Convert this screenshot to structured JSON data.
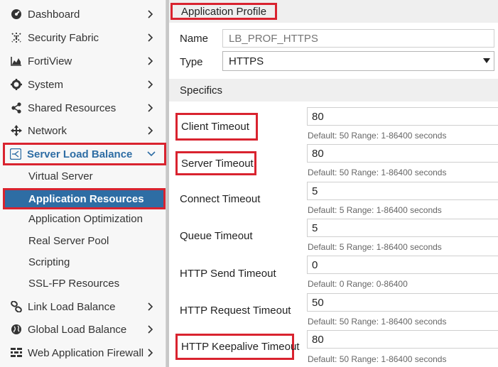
{
  "sidebar": {
    "items": [
      {
        "label": "Dashboard",
        "icon": "dashboard-icon"
      },
      {
        "label": "Security Fabric",
        "icon": "security-fabric-icon"
      },
      {
        "label": "FortiView",
        "icon": "fortiview-icon"
      },
      {
        "label": "System",
        "icon": "gear-icon"
      },
      {
        "label": "Shared Resources",
        "icon": "share-icon"
      },
      {
        "label": "Network",
        "icon": "network-icon"
      },
      {
        "label": "Server Load Balance",
        "icon": "server-load-balance-icon"
      },
      {
        "label": "Link Load Balance",
        "icon": "link-icon"
      },
      {
        "label": "Global Load Balance",
        "icon": "globe-icon"
      },
      {
        "label": "Web Application Firewall",
        "icon": "firewall-icon"
      }
    ],
    "sub_items": [
      {
        "label": "Virtual Server"
      },
      {
        "label": "Application Resources"
      },
      {
        "label": "Application Optimization"
      },
      {
        "label": "Real Server Pool"
      },
      {
        "label": "Scripting"
      },
      {
        "label": "SSL-FP Resources"
      }
    ]
  },
  "main": {
    "header": "Application Profile",
    "name_label": "Name",
    "name_placeholder": "LB_PROF_HTTPS",
    "type_label": "Type",
    "type_value": "HTTPS",
    "specifics_header": "Specifics",
    "fields": [
      {
        "label": "Client Timeout",
        "value": "80",
        "hint": "Default: 50 Range: 1-86400 seconds"
      },
      {
        "label": "Server Timeout",
        "value": "80",
        "hint": "Default: 50 Range: 1-86400 seconds"
      },
      {
        "label": "Connect Timeout",
        "value": "5",
        "hint": "Default: 5 Range: 1-86400 seconds"
      },
      {
        "label": "Queue Timeout",
        "value": "5",
        "hint": "Default: 5 Range: 1-86400 seconds"
      },
      {
        "label": "HTTP Send Timeout",
        "value": "0",
        "hint": "Default: 0 Range: 0-86400"
      },
      {
        "label": "HTTP Request Timeout",
        "value": "50",
        "hint": "Default: 50 Range: 1-86400 seconds"
      },
      {
        "label": "HTTP Keepalive Timeout",
        "value": "80",
        "hint": "Default: 50 Range: 1-86400 seconds"
      }
    ]
  },
  "colors": {
    "accent": "#2e6da4",
    "highlight": "#d9232f"
  }
}
